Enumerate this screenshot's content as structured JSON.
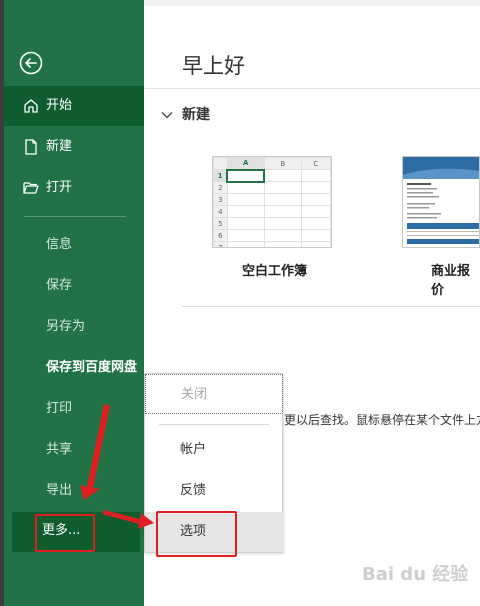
{
  "sidebar": {
    "back_icon": "back-arrow-circle-icon",
    "primary": [
      {
        "label": "开始",
        "icon": "home-icon",
        "active": true
      },
      {
        "label": "新建",
        "icon": "new-document-icon"
      },
      {
        "label": "打开",
        "icon": "open-folder-icon"
      }
    ],
    "secondary": [
      {
        "label": "信息"
      },
      {
        "label": "保存"
      },
      {
        "label": "另存为"
      },
      {
        "label": "保存到百度网盘",
        "bold": true
      },
      {
        "label": "打印"
      },
      {
        "label": "共享"
      },
      {
        "label": "导出"
      }
    ],
    "more_label": "更多..."
  },
  "main": {
    "greeting": "早上好",
    "new_section": {
      "title": "新建",
      "templates": [
        {
          "label": "空白工作簿"
        },
        {
          "label": "商业报价"
        }
      ],
      "blank_columns": [
        "A",
        "B",
        "C"
      ],
      "blank_rows": [
        "1",
        "2",
        "3",
        "4",
        "5",
        "6",
        "7"
      ]
    },
    "hint": "更以后查找。鼠标悬停在某个文件上方"
  },
  "popup_menu": {
    "close_label": "关闭",
    "account_label": "帐户",
    "feedback_label": "反馈",
    "options_label": "选项"
  },
  "watermark": "Bai du 经验",
  "colors": {
    "sidebar_green": "#217346",
    "active_green": "#0f5c2f",
    "annotation_red": "#e02020"
  }
}
